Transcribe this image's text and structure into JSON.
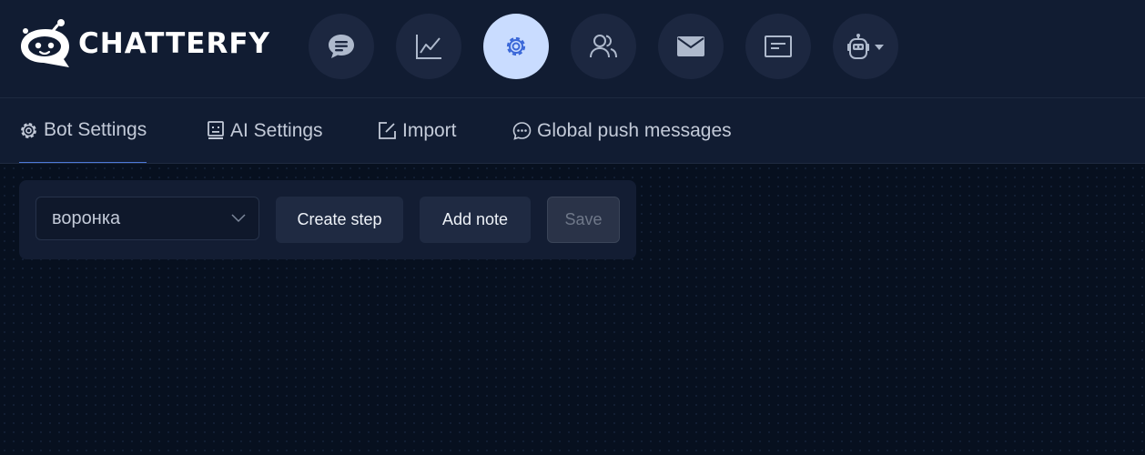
{
  "brand": {
    "name": "CHATTERFY"
  },
  "nav": [
    {
      "icon": "chat-icon",
      "active": false
    },
    {
      "icon": "analytics-icon",
      "active": false
    },
    {
      "icon": "settings-icon",
      "active": true
    },
    {
      "icon": "users-icon",
      "active": false
    },
    {
      "icon": "mail-icon",
      "active": false
    },
    {
      "icon": "message-card-icon",
      "active": false
    },
    {
      "icon": "bot-icon",
      "active": false
    }
  ],
  "tabs": [
    {
      "label": "Bot Settings",
      "icon": "gear-icon",
      "active": true
    },
    {
      "label": "AI Settings",
      "icon": "ai-icon",
      "active": false
    },
    {
      "label": "Import",
      "icon": "edit-icon",
      "active": false
    },
    {
      "label": "Global push messages",
      "icon": "chat-bubble-icon",
      "active": false
    }
  ],
  "toolbar": {
    "funnel_select": "воронка",
    "create_step_label": "Create step",
    "add_note_label": "Add note",
    "save_label": "Save"
  },
  "colors": {
    "background": "#0b1426",
    "header": "#111c32",
    "active_nav": "#c9dcff",
    "accent": "#4d79d8"
  }
}
